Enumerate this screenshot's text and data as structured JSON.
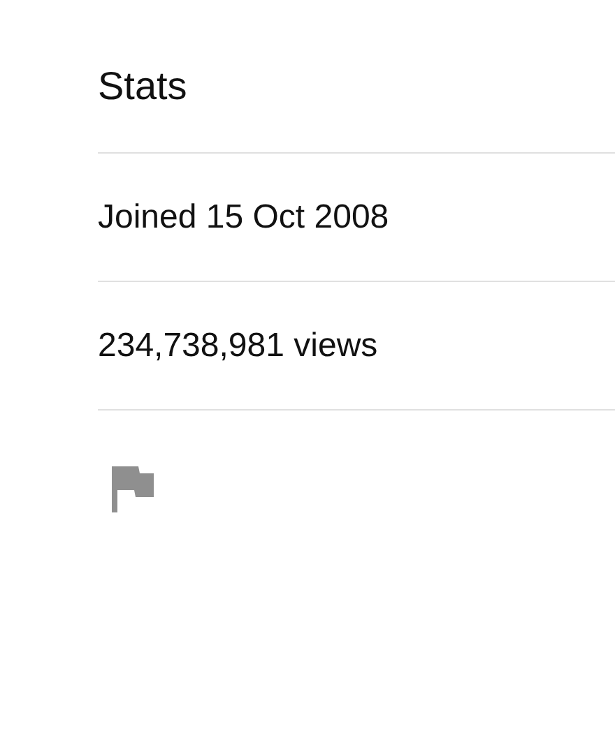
{
  "section": {
    "title": "Stats"
  },
  "stats": [
    "Joined 15 Oct 2008",
    "234,738,981 views"
  ]
}
